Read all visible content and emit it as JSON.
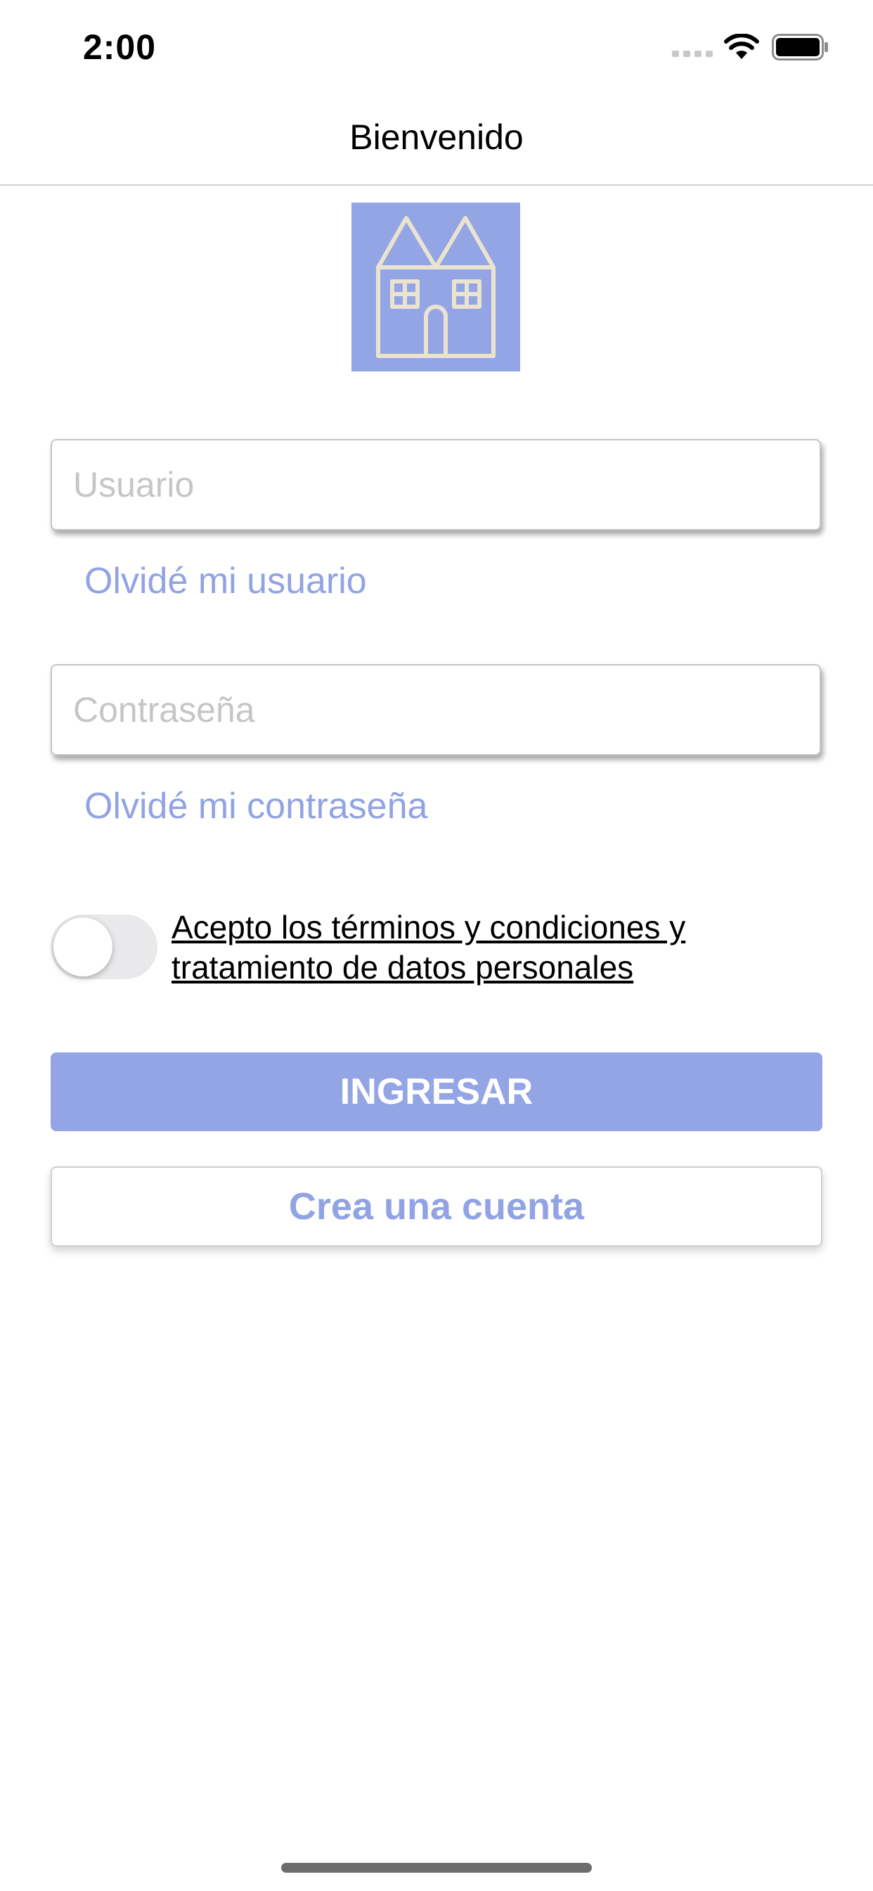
{
  "status_bar": {
    "time": "2:00",
    "icons": [
      "signal-icon",
      "wifi-icon",
      "battery-icon"
    ]
  },
  "nav": {
    "title": "Bienvenido"
  },
  "logo": {
    "icon": "house-icon",
    "background_color": "#93a5e5",
    "stroke_color": "#eae3ce"
  },
  "form": {
    "username": {
      "value": "",
      "placeholder": "Usuario"
    },
    "forgot_username": "Olvidé mi usuario",
    "password": {
      "value": "",
      "placeholder": "Contraseña"
    },
    "forgot_password": "Olvidé mi contraseña",
    "terms": {
      "toggle_on": false,
      "label_line1": "Acepto los términos y condiciones y",
      "label_line2": "tratamiento de datos personales"
    },
    "login_button": "INGRESAR",
    "create_account_button": "Crea una cuenta"
  },
  "colors": {
    "accent": "#93a5e5",
    "link": "#91a3e3",
    "placeholder": "#c6c6c8"
  }
}
